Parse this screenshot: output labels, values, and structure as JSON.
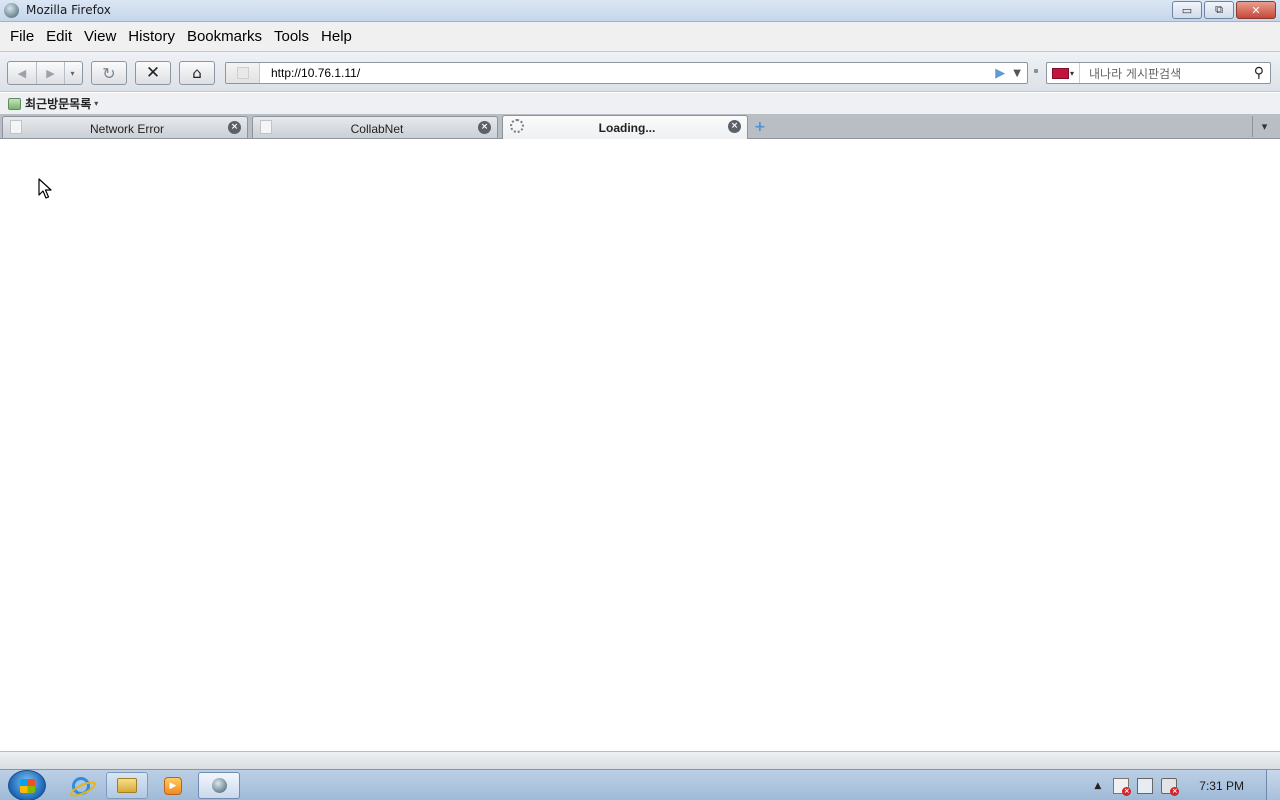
{
  "window": {
    "title": "Mozilla Firefox",
    "controls": {
      "minimize": "▭",
      "maximize": "⧉",
      "close": "✕"
    }
  },
  "menubar": {
    "items": [
      {
        "label": "File"
      },
      {
        "label": "Edit"
      },
      {
        "label": "View"
      },
      {
        "label": "History"
      },
      {
        "label": "Bookmarks"
      },
      {
        "label": "Tools"
      },
      {
        "label": "Help"
      }
    ]
  },
  "navigation": {
    "url": "http://10.76.1.11/",
    "search_placeholder": "내나라 게시판검색",
    "icons": {
      "back": "◀",
      "forward": "▶",
      "history_dropdown": "▾",
      "reload": "↻",
      "stop": "✕",
      "home": "⌂",
      "go": "▶",
      "url_dropdown": "▼",
      "search": "⚲"
    }
  },
  "bookmarks": {
    "items": [
      {
        "label": "최근방문목록",
        "arrow": "▾"
      }
    ]
  },
  "tabs": {
    "items": [
      {
        "label": "Network Error",
        "state": "inactive"
      },
      {
        "label": "CollabNet",
        "state": "inactive"
      },
      {
        "label": "Loading...",
        "state": "loading"
      }
    ],
    "close_glyph": "×",
    "new_tab_glyph": "+",
    "list_glyph": "▾"
  },
  "taskbar": {
    "apps": [
      {
        "name": "internet-explorer"
      },
      {
        "name": "windows-explorer"
      },
      {
        "name": "media-player"
      },
      {
        "name": "firefox",
        "active": true
      }
    ],
    "tray_arrow": "▲",
    "clock": "7:31 PM"
  },
  "colors": {
    "titlebar": "#c6d6ea",
    "tabstrip": "#b9bec5",
    "taskbar": "#9fbad8",
    "new_tab_accent": "#4e8fd6"
  }
}
